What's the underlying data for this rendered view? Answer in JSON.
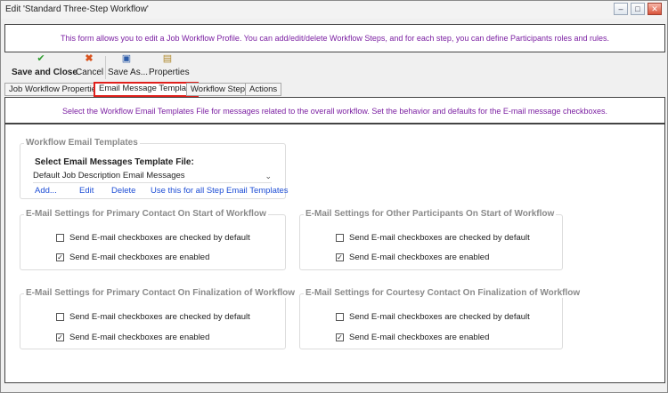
{
  "window": {
    "title": "Edit 'Standard Three-Step Workflow'"
  },
  "info_text": "This form allows you to edit a Job Workflow Profile. You can add/edit/delete Workflow Steps, and for each step, you can define Participants roles and rules.",
  "toolbar": {
    "save_close": "Save and Close",
    "cancel": "Cancel",
    "save_as": "Save As...",
    "properties": "Properties"
  },
  "tabs": [
    {
      "label": "Job Workflow Properties"
    },
    {
      "label": "Email Message Template"
    },
    {
      "label": "Workflow Steps"
    },
    {
      "label": "Actions"
    }
  ],
  "description": "Select the Workflow Email Templates File for messages related to the overall workflow. Set the behavior and defaults for the E-mail message checkboxes.",
  "templates": {
    "legend": "Workflow Email Templates",
    "field_label": "Select Email Messages Template File:",
    "selected": "Default Job Description Email Messages",
    "links": {
      "add": "Add...",
      "edit": "Edit",
      "delete": "Delete",
      "use_all": "Use this for all Step Email Templates"
    }
  },
  "groups": {
    "primary_start": {
      "legend": "E-Mail Settings for Primary Contact On Start of Workflow",
      "cb1": {
        "label": "Send E-mail checkboxes are checked by default",
        "checked": false
      },
      "cb2": {
        "label": "Send E-mail checkboxes are enabled",
        "checked": true
      }
    },
    "other_start": {
      "legend": "E-Mail Settings for Other Participants On Start of Workflow",
      "cb1": {
        "label": "Send E-mail checkboxes are checked by default",
        "checked": false
      },
      "cb2": {
        "label": "Send E-mail checkboxes are enabled",
        "checked": true
      }
    },
    "primary_final": {
      "legend": "E-Mail Settings for Primary Contact On Finalization of Workflow",
      "cb1": {
        "label": "Send E-mail checkboxes are checked by default",
        "checked": false
      },
      "cb2": {
        "label": "Send E-mail checkboxes are enabled",
        "checked": true
      }
    },
    "courtesy_final": {
      "legend": "E-Mail Settings for Courtesy Contact On Finalization of Workflow",
      "cb1": {
        "label": "Send E-mail checkboxes are checked by default",
        "checked": false
      },
      "cb2": {
        "label": "Send E-mail checkboxes are enabled",
        "checked": true
      }
    }
  }
}
